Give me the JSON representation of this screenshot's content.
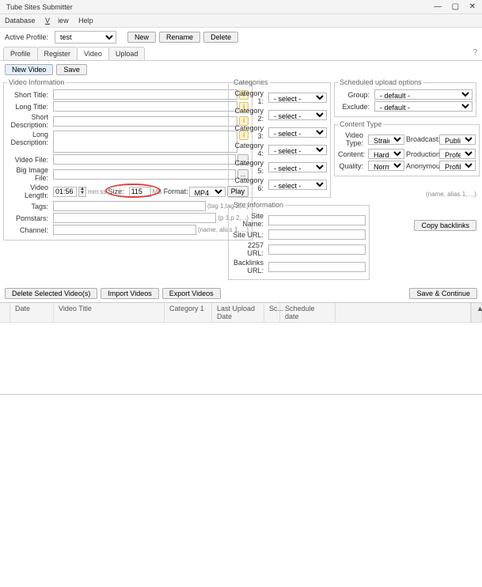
{
  "title": "Tube Sites Submitter",
  "menu": {
    "database": "Database",
    "view": "View",
    "help": "Help",
    "view_underline": "V"
  },
  "profile": {
    "label": "Active Profile:",
    "value": "test",
    "new": "New",
    "rename": "Rename",
    "delete": "Delete"
  },
  "tabs": {
    "profile": "Profile",
    "register": "Register",
    "video": "Video",
    "upload": "Upload"
  },
  "buttons": {
    "new_video": "New Video",
    "save": "Save"
  },
  "video_info": {
    "legend": "Video Information",
    "short_title": "Short Title:",
    "long_title": "Long Title:",
    "short_desc": "Short Description:",
    "long_desc": "Long Description:",
    "video_file": "Video File:",
    "big_image_file": "Big Image File:",
    "video_length": "Video Length:",
    "length_value": "01:56",
    "mmss": "mm:ss",
    "size": "Size:",
    "size_value": "115",
    "mb": "MB",
    "format": "Format:",
    "format_value": "MP4",
    "play": "Play",
    "tags": "Tags:",
    "tags_hint": "(tag 1,tag 2,...)",
    "pornstars": "Pornstars:",
    "pornstars_hint": "(p 1,p 2,...)",
    "channel": "Channel:",
    "channel_hint": "(name, alias 1, ...)"
  },
  "categories": {
    "legend": "Categories",
    "c1": "Category 1:",
    "c2": "Category 2:",
    "c3": "Category 3:",
    "c4": "Category 4:",
    "c5": "Category 5:",
    "c6": "Category 6:",
    "select": "- select -"
  },
  "scheduled": {
    "legend": "Scheduled upload options",
    "group": "Group:",
    "exclude": "Exclude:",
    "default": "- default -"
  },
  "content_type": {
    "legend": "Content Type",
    "video_type": "Video Type:",
    "video_type_v": "Straight",
    "broadcast": "Broadcast:",
    "broadcast_v": "Public",
    "content": "Content:",
    "content_v": "Hardcore",
    "production": "Production:",
    "production_v": "Professional",
    "quality": "Quality:",
    "quality_v": "Normal",
    "anonymous": "Anonymous:",
    "anonymous_v": "Profile"
  },
  "site_info": {
    "legend": "Site Information",
    "site_name": "Site Name:",
    "site_name_hint": "(name, alias 1, ...)",
    "site_url": "Site URL:",
    "url_2257": "2257 URL:",
    "backlinks": "Backlinks URL:",
    "copy": "Copy backlinks"
  },
  "bottom": {
    "delete_selected": "Delete Selected Video(s)",
    "import": "Import Videos",
    "export": "Export Videos",
    "save_continue": "Save & Continue"
  },
  "table": {
    "date": "Date",
    "title": "Video Title",
    "category": "Category 1",
    "last_upload": "Last Upload Date",
    "sc": "Sc...",
    "schedule": "Schedule date"
  },
  "chart_data": {
    "type": "table",
    "columns": [
      "Date",
      "Video Title",
      "Category 1",
      "Last Upload Date",
      "Sc...",
      "Schedule date"
    ],
    "rows": []
  }
}
